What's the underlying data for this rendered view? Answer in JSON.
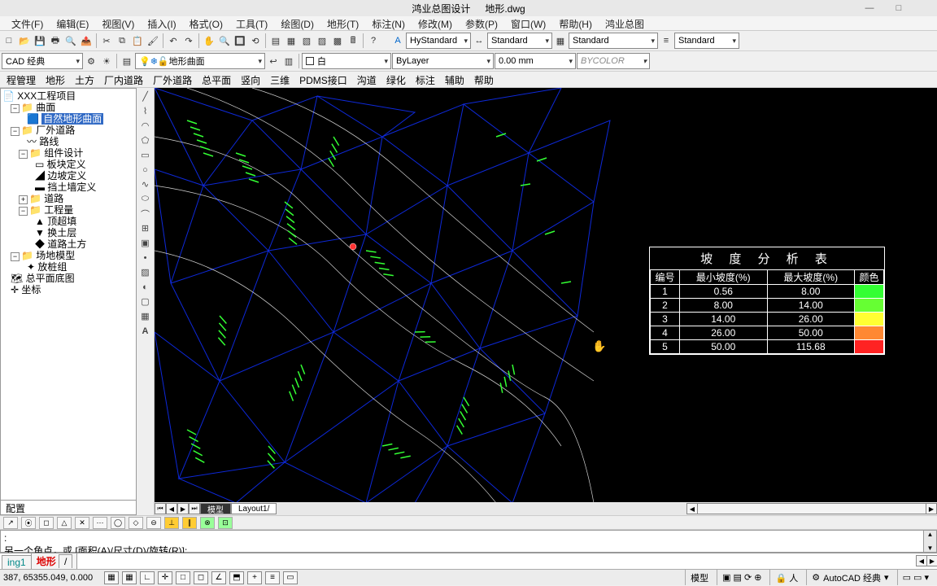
{
  "title": {
    "app": "鸿业总图设计",
    "file": "地形.dwg"
  },
  "win": {
    "min": "—",
    "max": "□",
    "close": ""
  },
  "menu": [
    "文件(F)",
    "编辑(E)",
    "视图(V)",
    "插入(I)",
    "格式(O)",
    "工具(T)",
    "绘图(D)",
    "地形(T)",
    "标注(N)",
    "修改(M)",
    "参数(P)",
    "窗口(W)",
    "帮助(H)",
    "鸿业总图"
  ],
  "toolbar1": {
    "styles": {
      "text": "HyStandard",
      "dim": "Standard",
      "table": "Standard",
      "ml": "Standard"
    }
  },
  "toolbar2": {
    "workspace": "CAD 经典",
    "layer": "地形曲面",
    "color": "白",
    "linetype": "ByLayer",
    "lineweight": "0.00 mm",
    "plotstyle": "BYCOLOR"
  },
  "tabs": [
    "程管理",
    "地形",
    "土方",
    "厂内道路",
    "厂外道路",
    "总平面",
    "竖向",
    "三维",
    "PDMS接口",
    "沟道",
    "绿化",
    "标注",
    "辅助",
    "帮助"
  ],
  "tree": {
    "root": "XXX工程项目",
    "n_surface": "曲面",
    "n_natural": "自然地形曲面",
    "n_outroad": "厂外道路",
    "n_route": "路线",
    "n_component": "组件设计",
    "n_block": "板块定义",
    "n_slope": "边坡定义",
    "n_retain": "挡土墙定义",
    "n_road": "道路",
    "n_qty": "工程量",
    "n_top": "顶超填",
    "n_exch": "换土层",
    "n_roadcut": "道路土方",
    "n_site": "场地模型",
    "n_stake": "放桩组",
    "n_baseplan": "总平面底图",
    "n_coord": "坐标",
    "footer": "配置"
  },
  "slope": {
    "title": "坡 度 分 析 表",
    "headers": [
      "编号",
      "最小坡度(%)",
      "最大坡度(%)",
      "颜色"
    ],
    "rows": [
      {
        "id": "1",
        "min": "0.56",
        "max": "8.00",
        "color": "#33ff33"
      },
      {
        "id": "2",
        "min": "8.00",
        "max": "14.00",
        "color": "#66ff33"
      },
      {
        "id": "3",
        "min": "14.00",
        "max": "26.00",
        "color": "#ffff33"
      },
      {
        "id": "4",
        "min": "26.00",
        "max": "50.00",
        "color": "#ff8833"
      },
      {
        "id": "5",
        "min": "50.00",
        "max": "115.68",
        "color": "#ff2222"
      }
    ]
  },
  "modeltabs": {
    "model": "模型",
    "layout": "Layout1"
  },
  "cmd": {
    "line1": ":",
    "line2": "另一个角点，或 [面积(A)/尺寸(D)/旋转(R)]:"
  },
  "drawtabs": {
    "t1": "ing1",
    "t2": "地形",
    "sep": "/"
  },
  "status": {
    "coords": "387, 65355.049, 0.000",
    "right_label": "模型",
    "ws_label": "AutoCAD 经典"
  }
}
